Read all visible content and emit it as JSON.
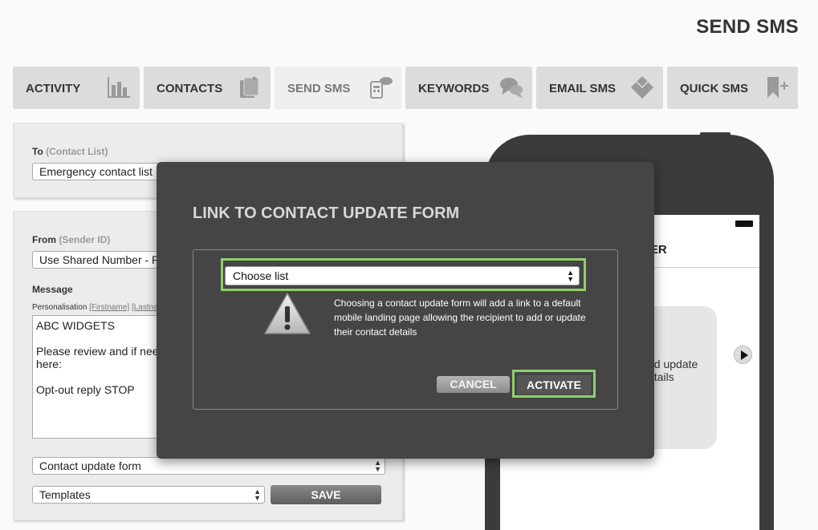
{
  "page": {
    "title": "SEND SMS"
  },
  "tabs": [
    {
      "label": "ACTIVITY",
      "icon": "bar-chart-icon"
    },
    {
      "label": "CONTACTS",
      "icon": "contacts-icon"
    },
    {
      "label": "SEND SMS",
      "icon": "phone-message-icon",
      "active": true
    },
    {
      "label": "KEYWORDS",
      "icon": "speech-bubbles-icon"
    },
    {
      "label": "EMAIL SMS",
      "icon": "envelope-icon"
    },
    {
      "label": "QUICK SMS",
      "icon": "bookmark-add-icon"
    }
  ],
  "to_panel": {
    "label": "To",
    "sublabel": "(Contact List)",
    "value": "Emergency contact list"
  },
  "from_panel": {
    "label": "From",
    "sublabel": "(Sender ID)",
    "value": "Use Shared Number - R"
  },
  "message": {
    "label": "Message",
    "personalisation": "Personalisation",
    "firstname": "[Firstname]",
    "lastname": "[Lastna",
    "body": "ABC WIDGETS\n\nPlease review and if nee\nhere:\n\nOpt-out reply STOP"
  },
  "contact_update_select": {
    "value": "Contact update form"
  },
  "templates_select": {
    "value": "Templates"
  },
  "save_button": {
    "label": "SAVE"
  },
  "phone_preview": {
    "header_text": "BER",
    "bubble_text": "ed update\netails"
  },
  "modal": {
    "title": "LINK TO CONTACT UPDATE FORM",
    "select_value": "Choose list",
    "description": "Choosing a contact update form will add a link to a default mobile landing page allowing the recipient to add or update their contact details",
    "cancel_label": "CANCEL",
    "activate_label": "ACTIVATE"
  },
  "colors": {
    "highlight": "#8fcf6a",
    "modal_bg": "#454545",
    "tab_bg": "#dcdcdc",
    "phone_body": "#3b3b3b"
  }
}
